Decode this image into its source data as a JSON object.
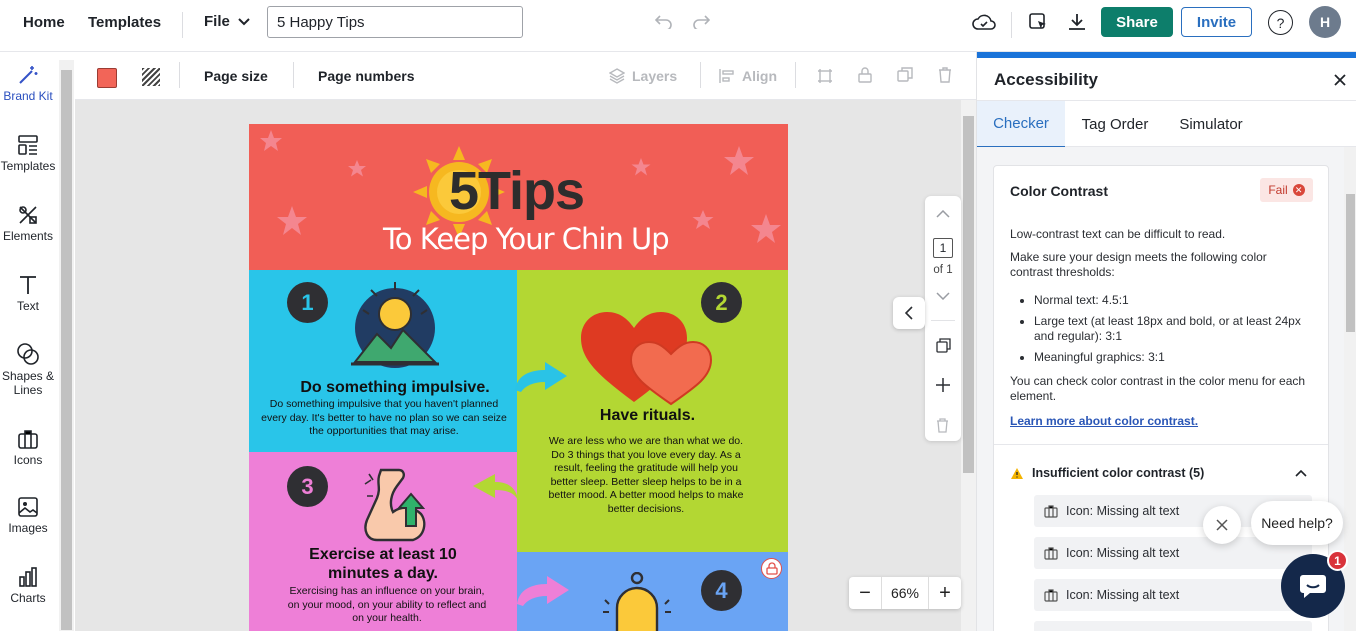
{
  "topbar": {
    "home": "Home",
    "templates": "Templates",
    "file": "File",
    "document_title": "5 Happy Tips",
    "share": "Share",
    "invite": "Invite",
    "help": "?",
    "avatar_initial": "H"
  },
  "sidebar": {
    "items": [
      {
        "label": "Brand Kit",
        "icon": "wand-icon"
      },
      {
        "label": "Templates",
        "icon": "templates-icon"
      },
      {
        "label": "Elements",
        "icon": "elements-icon"
      },
      {
        "label": "Text",
        "icon": "text-icon"
      },
      {
        "label": "Shapes &\nLines",
        "icon": "shapes-icon"
      },
      {
        "label": "Icons",
        "icon": "briefcase-icon"
      },
      {
        "label": "Images",
        "icon": "image-icon"
      },
      {
        "label": "Charts",
        "icon": "chart-icon"
      }
    ]
  },
  "toolbar": {
    "page_size": "Page size",
    "page_numbers": "Page numbers",
    "layers": "Layers",
    "align": "Align",
    "fill_color": "#f26558"
  },
  "infographic": {
    "title_number": "5",
    "title_word": "Tips",
    "subtitle": "To Keep Your Chin Up",
    "tips": [
      {
        "number": "1",
        "heading": "Do something impulsive.",
        "body": "Do something impulsive that you haven't planned every day. It's better to have no plan so we can seize the opportunities that may arise."
      },
      {
        "number": "2",
        "heading": "Have rituals.",
        "body": "We are less who we are than what we do. Do 3 things that you love every day. As a result, feeling the gratitude will help you better sleep. Better sleep helps to be in a better mood. A better mood helps to make better decisions."
      },
      {
        "number": "3",
        "heading": "Exercise at least 10 minutes a day.",
        "body": "Exercising has an influence on your brain, on your mood, on your ability to reflect and on your health."
      },
      {
        "number": "4",
        "heading": "",
        "body": ""
      }
    ],
    "colors": {
      "header": "#f15e56",
      "tip1": "#29c5e9",
      "tip2": "#b3d733",
      "tip3": "#ee7fd7",
      "tip4": "#6aa4f4"
    }
  },
  "page_nav": {
    "current": "1",
    "of": "of 1"
  },
  "zoom": {
    "minus": "−",
    "value": "66%",
    "plus": "+"
  },
  "accessibility": {
    "title": "Accessibility",
    "tabs": [
      "Checker",
      "Tag Order",
      "Simulator"
    ],
    "active_tab": "Checker",
    "card": {
      "title": "Color Contrast",
      "status": "Fail",
      "intro": "Low-contrast text can be difficult to read.",
      "thresholds_intro": "Make sure your design meets the following color contrast thresholds:",
      "thresholds": [
        "Normal text: 4.5:1",
        "Large text (at least 18px and bold, or at least 24px and regular): 3:1",
        "Meaningful graphics: 3:1"
      ],
      "note": "You can check color contrast in the color menu for each element.",
      "link": "Learn more about color contrast.",
      "issues_title": "Insufficient color contrast (5)",
      "issues": [
        "Icon: Missing alt text",
        "Icon: Missing alt text",
        "Icon: Missing alt text"
      ]
    }
  },
  "help_widget": {
    "text": "Need help?",
    "badge": "1"
  }
}
